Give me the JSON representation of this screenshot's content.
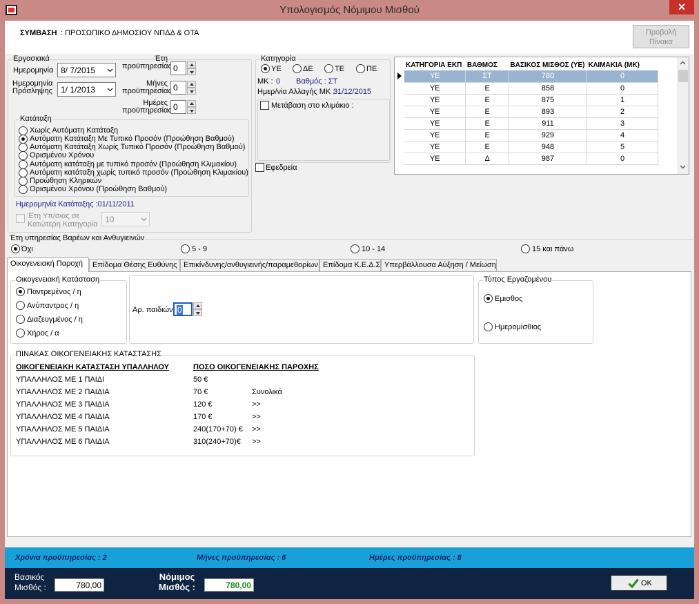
{
  "window": {
    "title": "Υπολογισμός Νόμιμου Μισθού",
    "close": "✕"
  },
  "header": {
    "contract_label": "ΣΥΜΒΑΣΗ",
    "contract_value": ": ΠΡΟΣΩΠΙΚΟ ΔΗΜΟΣΙΟΥ ΝΠΔΔ & ΟΤΑ",
    "view_table_line1": "Προβολή",
    "view_table_line2": "Πίνακα"
  },
  "work": {
    "legend": "Εργασιακά",
    "date_label_1": "Ημερομηνία",
    "date_value": "8/ 7/2015",
    "hire_label_1": "Ημερομηνία",
    "hire_label_2": "Πρόσληψης",
    "hire_value": "1/ 1/2013",
    "years_label_1": "Έτη",
    "years_label_2": "προϋπηρεσίας",
    "years_value": "0",
    "months_label_1": "Μήνες",
    "months_label_2": "προϋπηρεσίας",
    "months_value": "0",
    "days_label_1": "Ημέρες",
    "days_label_2": "προϋπηρεσίας",
    "days_value": "0"
  },
  "classification": {
    "legend": "Κατάταξη",
    "options": [
      {
        "label": "Χωρίς Αυτόματη Κατάταξη",
        "selected": false
      },
      {
        "label": "Αυτόματη Κατάταξη Με Τυπικό Προσόν (Προώθηση Βαθμού)",
        "selected": true
      },
      {
        "label": "Αυτόματη Κατάταξη Χωρίς Τυπικό Προσόν (Προώθηση Βαθμού)",
        "selected": false
      },
      {
        "label": "Ορισμένου Χρόνου",
        "selected": false
      },
      {
        "label": "Αυτόματη κατάταξη με τυπικό προσόν (Προώθηση Κλιμακίου)",
        "selected": false
      },
      {
        "label": "Αυτόματη κατάταξη χωρίς τυπικό προσόν (Προώθηση Κλιμακίου)",
        "selected": false
      },
      {
        "label": "Προώθηση Κληρικών",
        "selected": false
      },
      {
        "label": "Ορισμένου Χρόνου (Προώθηση Βαθμού)",
        "selected": false
      }
    ],
    "date_label": "Ημερομηνία Κατάταξης :01/11/2011",
    "lower_years_line1": "Έτη Υπ/σιας σε",
    "lower_years_line2": "Κατώτερη Κατηγορία",
    "lower_years_value": "10"
  },
  "category": {
    "legend": "Κατηγορία",
    "options": [
      {
        "label": "ΥΕ",
        "selected": true
      },
      {
        "label": "ΔΕ",
        "selected": false
      },
      {
        "label": "ΤΕ",
        "selected": false
      },
      {
        "label": "ΠΕ",
        "selected": false
      }
    ],
    "mk_label": "ΜΚ :",
    "mk_value": "0",
    "grade_label": "Βαθμός : ΣΤ",
    "mk_change_label": "Ημερ/νία Αλλαγής ΜΚ :",
    "mk_change_value": "31/12/2015",
    "transition_label": "Μετάβαση στο κλιμάκιο :",
    "reserve_label": "Εφεδρεία"
  },
  "grid": {
    "columns": [
      "ΚΑΤΗΓΟΡΙΑ ΕΚΠ",
      "ΒΑΘΜΟΣ",
      "ΒΑΣΙΚΟΣ ΜΙΣΘΟΣ (ΥΕ)",
      "ΚΛΙΜΑΚΙΑ (ΜΚ)"
    ],
    "rows": [
      [
        "ΥΕ",
        "ΣΤ",
        "780",
        "0"
      ],
      [
        "ΥΕ",
        "Ε",
        "858",
        "0"
      ],
      [
        "ΥΕ",
        "Ε",
        "875",
        "1"
      ],
      [
        "ΥΕ",
        "Ε",
        "893",
        "2"
      ],
      [
        "ΥΕ",
        "Ε",
        "911",
        "3"
      ],
      [
        "ΥΕ",
        "Ε",
        "929",
        "4"
      ],
      [
        "ΥΕ",
        "Ε",
        "948",
        "5"
      ],
      [
        "ΥΕ",
        "Δ",
        "987",
        "0"
      ]
    ]
  },
  "hazard": {
    "legend": "Έτη υπηρεσίας Βαρέων και Ανθυγιεινών",
    "options": [
      {
        "label": "Όχι",
        "selected": true
      },
      {
        "label": "5 - 9",
        "selected": false
      },
      {
        "label": "10 - 14",
        "selected": false
      },
      {
        "label": "15 και πάνω",
        "selected": false
      }
    ]
  },
  "tabs": [
    {
      "label": "Οικογενειακή Παροχή",
      "active": true
    },
    {
      "label": "Επίδομα Θέσης Ευθύνης",
      "active": false
    },
    {
      "label": "Επικίνδυνης/ανθυγιεινής/παραμεθορίων",
      "active": false
    },
    {
      "label": "Επίδομα Κ.Ε.Δ.Σ",
      "active": false
    },
    {
      "label": "Υπερβάλλουσα Αύξηση / Μείωση",
      "active": false
    }
  ],
  "family": {
    "legend": "Οικογενειακή Κατάσταση",
    "options": [
      {
        "label": "Παντρεμένος / η",
        "selected": true
      },
      {
        "label": "Ανύπαντρος / η",
        "selected": false
      },
      {
        "label": "Διαζευγμένος / η",
        "selected": false
      },
      {
        "label": "Χήρος / α",
        "selected": false
      }
    ],
    "children_label": "Αρ. παιδιών",
    "children_value": "0"
  },
  "employee_type": {
    "legend": "Τύπος Εργαζομένου",
    "options": [
      {
        "label": "Εμισθος",
        "selected": true
      },
      {
        "label": "Ημερομίσθιος",
        "selected": false
      }
    ]
  },
  "family_table": {
    "legend": "ΠΙΝΑΚΑΣ ΟΙΚΟΓΕΝΕΙΑΚΗΣ ΚΑΤΑΣΤΑΣΗΣ",
    "col1": "ΟΙΚΟΓΕΝΕΙΑΚΗ ΚΑΤΑΣΤΑΣΗ ΥΠΑΛΛΗΛΟΥ",
    "col2": "ΠΟΣΟ ΟΙΚΟΓΕΝΕΙΑΚΗΣ ΠΑΡΟΧΗΣ",
    "rows": [
      {
        "status": "ΥΠΑΛΛΗΛΟΣ ΜΕ 1 ΠΑΙΔΙ",
        "amount": "50 €",
        "note": ""
      },
      {
        "status": "ΥΠΑΛΛΗΛΟΣ ΜΕ 2 ΠΑΙΔΙΑ",
        "amount": "70 €",
        "note": "Συνολικά"
      },
      {
        "status": "ΥΠΑΛΛΗΛΟΣ ΜΕ 3 ΠΑΙΔΙΑ",
        "amount": "120 €",
        "note": ">>"
      },
      {
        "status": "ΥΠΑΛΛΗΛΟΣ ΜΕ 4 ΠΑΙΔΙΑ",
        "amount": "170 €",
        "note": ">>"
      },
      {
        "status": "ΥΠΑΛΛΗΛΟΣ ΜΕ 5 ΠΑΙΔΙΑ",
        "amount": "240(170+70) €",
        "note": ">>"
      },
      {
        "status": "ΥΠΑΛΛΗΛΟΣ ΜΕ 6 ΠΑΙΔΙΑ",
        "amount": "310(240+70)€",
        "note": ">>"
      }
    ]
  },
  "info": {
    "years": "Χρόνια προϋπηρεσίας : 2",
    "months": "Μήνες προϋπηρεσίας : 6",
    "days": "Ημέρες προϋπηρεσίας : 8"
  },
  "footer": {
    "basic_label_1": "Βασικός",
    "basic_label_2": "Μισθός :",
    "basic_value": "780,00",
    "legal_label_1": "Νόμιμος",
    "legal_label_2": "Μισθός :",
    "legal_value": "780,00",
    "ok_label": "OK"
  },
  "colors": {
    "titlebar": "#c98a85",
    "info_bar": "#1aa0d8",
    "footer_bar": "#0f2442",
    "selected_row": "#99b4d1",
    "legal_value": "#1a8a1a"
  }
}
